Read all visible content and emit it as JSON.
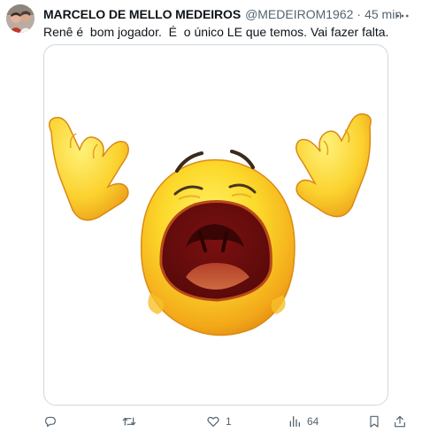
{
  "post": {
    "author": {
      "display_name": "MARCELO DE MELLO MEDEIROS",
      "handle": "@MEDEIROM1962",
      "separator": "·",
      "time": "45 min"
    },
    "text": "Renê é  bom jogador.  É  o único LE que temos. Vai fazer falta.",
    "media": {
      "description_icon": "crying-emoji"
    },
    "actions": {
      "reply_count": "",
      "repost_count": "",
      "like_count": "1",
      "view_count": "64"
    }
  },
  "icons": {
    "more": "more-horizontal-icon",
    "reply": "reply-icon",
    "repost": "repost-icon",
    "like": "heart-icon",
    "views": "views-icon",
    "bookmark": "bookmark-icon",
    "share": "share-icon"
  },
  "colors": {
    "text_primary": "#0f1419",
    "text_secondary": "#536471",
    "border": "#cfd9de"
  }
}
